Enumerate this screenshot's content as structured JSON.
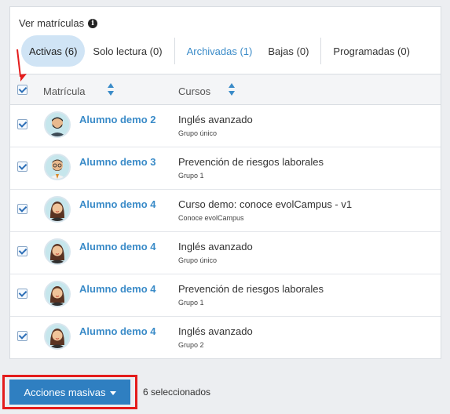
{
  "panel": {
    "title": "Ver matrículas",
    "tabs": [
      {
        "label": "Activas (6)",
        "active": true
      },
      {
        "label": "Solo lectura (0)"
      },
      {
        "label": "Archivadas (1)",
        "link": true
      },
      {
        "label": "Bajas (0)"
      },
      {
        "label": "Programadas (0)"
      }
    ]
  },
  "table": {
    "columns": [
      "Matrícula",
      "Cursos"
    ],
    "rows": [
      {
        "name": "Alumno demo 2",
        "course": "Inglés avanzado",
        "group": "Grupo único",
        "avatar": "male-bearded-avatar"
      },
      {
        "name": "Alumno demo 3",
        "course": "Prevención de riesgos laborales",
        "group": "Grupo 1",
        "avatar": "male-glasses-avatar"
      },
      {
        "name": "Alumno demo 4",
        "course": "Curso demo: conoce evolCampus - v1",
        "group": "Conoce evolCampus",
        "avatar": "female-avatar"
      },
      {
        "name": "Alumno demo 4",
        "course": "Inglés avanzado",
        "group": "Grupo único",
        "avatar": "female-avatar"
      },
      {
        "name": "Alumno demo 4",
        "course": "Prevención de riesgos laborales",
        "group": "Grupo 1",
        "avatar": "female-avatar"
      },
      {
        "name": "Alumno demo 4",
        "course": "Inglés avanzado",
        "group": "Grupo 2",
        "avatar": "female-avatar"
      }
    ]
  },
  "footer": {
    "bulk_label": "Acciones masivas",
    "selected_text": "6 seleccionados"
  },
  "colors": {
    "accent": "#2f7fc1",
    "link": "#3a8bc8",
    "annotation": "#e41c1c"
  }
}
